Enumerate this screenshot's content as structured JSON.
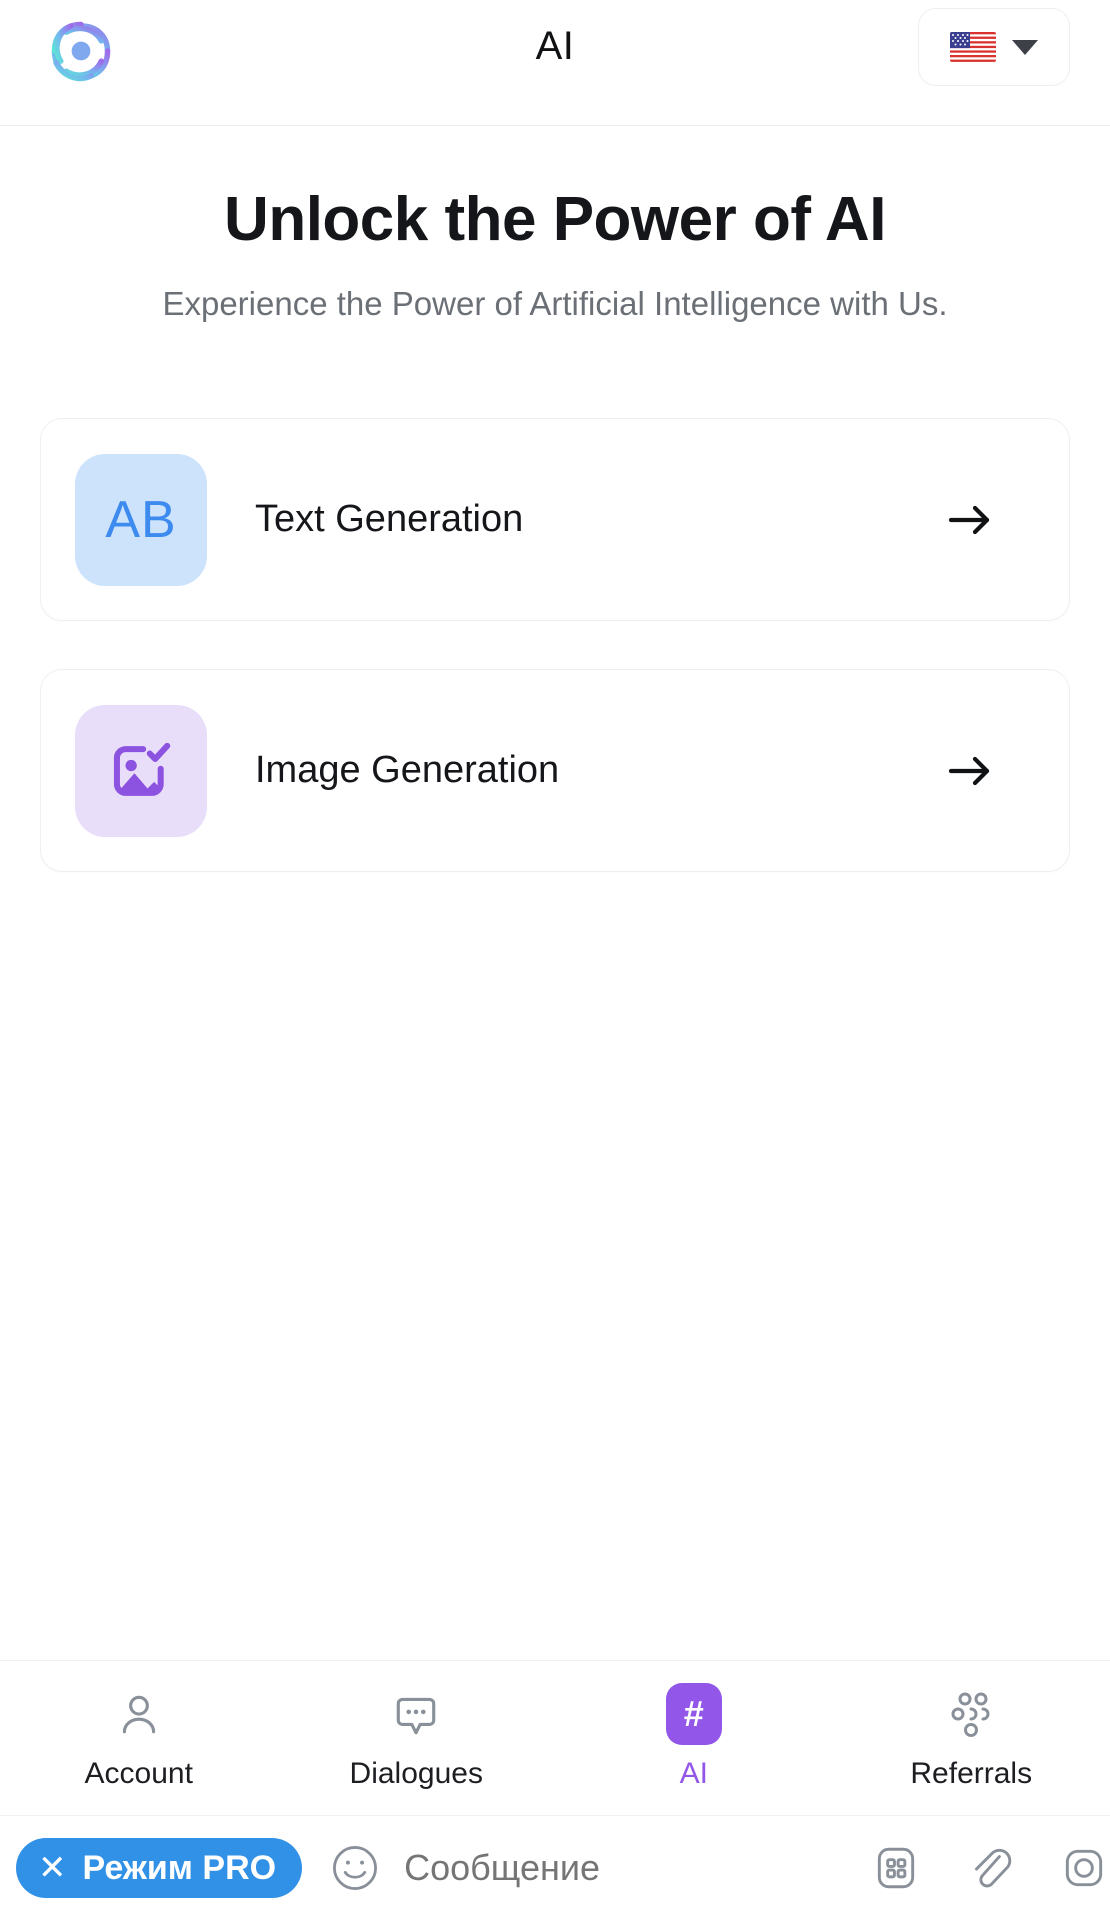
{
  "topbar": {
    "logo_icon": "ai-swirl-logo-icon",
    "title": "AI",
    "language": {
      "flag": "us-flag-icon",
      "caret_icon": "chevron-down-icon"
    }
  },
  "hero": {
    "title": "Unlock the Power of AI",
    "subtitle": "Experience the Power of Artificial Intelligence with Us."
  },
  "cards": [
    {
      "icon_label": "AB",
      "icon_name": "text-generation-icon",
      "icon_bg": "#cce3fb",
      "icon_fg": "#3d8bef",
      "label": "Text Generation",
      "arrow_icon": "arrow-right-icon"
    },
    {
      "icon_label": "",
      "icon_name": "image-generation-icon",
      "icon_bg": "#e9def9",
      "icon_fg": "#8c52e0",
      "label": "Image Generation",
      "arrow_icon": "arrow-right-icon"
    }
  ],
  "bottom_nav": {
    "active": "AI",
    "active_color": "#9257e8",
    "items": [
      {
        "label": "Account",
        "icon": "person-icon",
        "active": false
      },
      {
        "label": "Dialogues",
        "icon": "chat-bubble-dots-icon",
        "active": false
      },
      {
        "label": "AI",
        "icon": "hash-badge-icon",
        "active": true
      },
      {
        "label": "Referrals",
        "icon": "group-people-icon",
        "active": false
      }
    ]
  },
  "message_bar": {
    "pro_button": {
      "close_icon": "close-x-icon",
      "label": "Режим PRO",
      "color": "#3191e7"
    },
    "emoji_icon": "smiley-face-icon",
    "input_placeholder": "Сообщение",
    "input_value": "",
    "actions": [
      {
        "icon": "keyboard-grid-icon"
      },
      {
        "icon": "paperclip-icon"
      },
      {
        "icon": "camera-icon"
      }
    ]
  }
}
